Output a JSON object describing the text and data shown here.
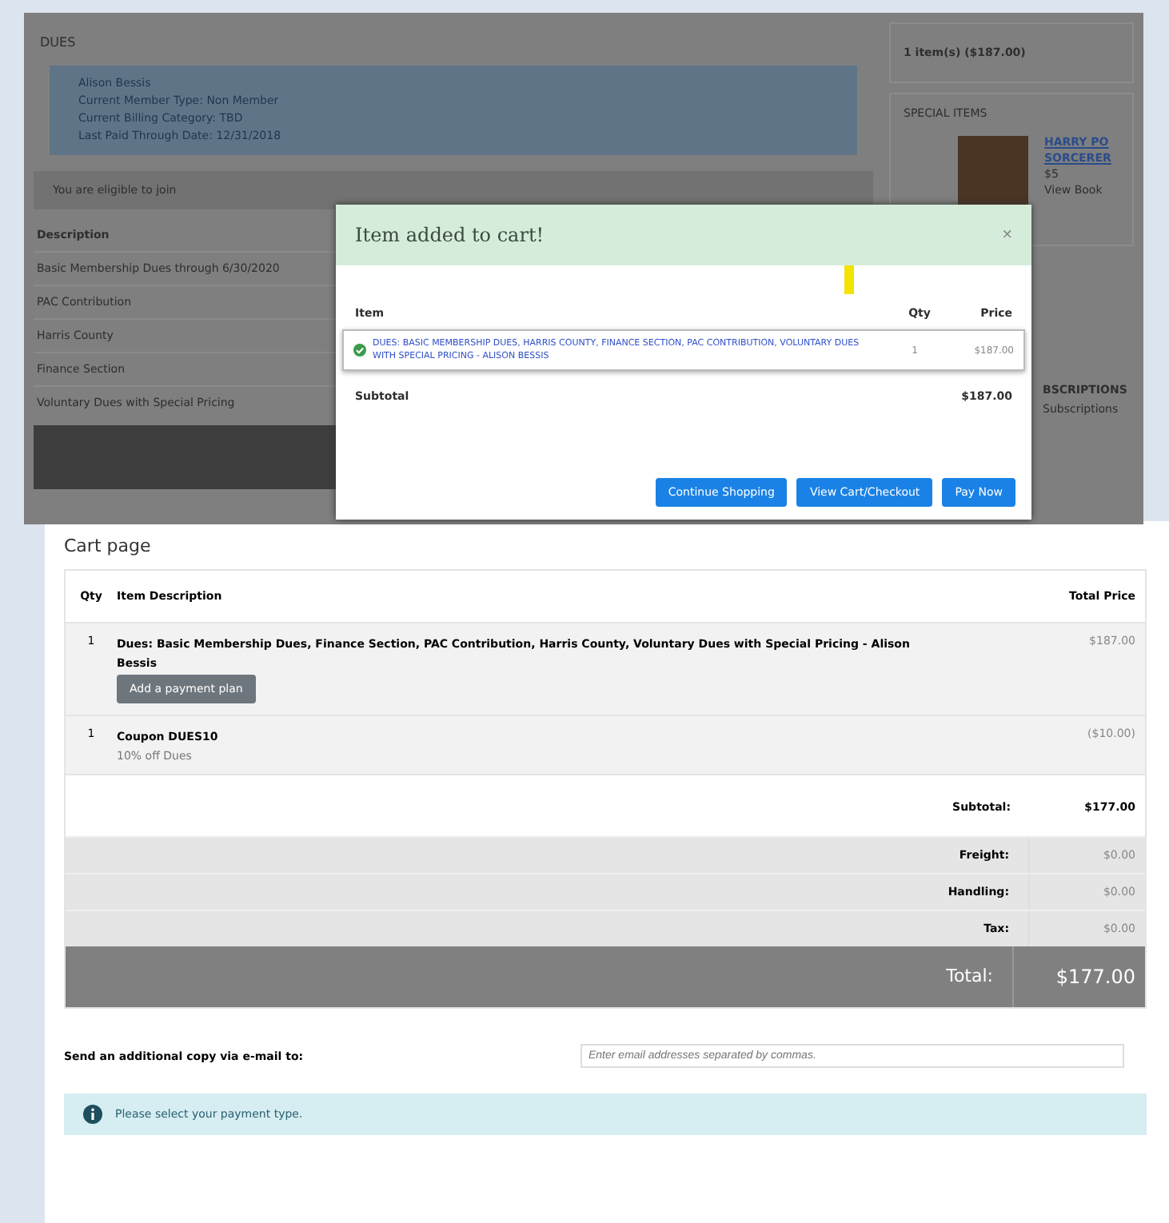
{
  "background_page": {
    "heading": "DUES",
    "member_info": [
      "Alison Bessis",
      "Current Member Type: Non Member",
      "Current Billing Category: TBD",
      "Last Paid Through Date: 12/31/2018"
    ],
    "eligibility": "You are eligible to join",
    "description_heading": "Description",
    "dues_items": [
      "Basic Membership Dues through 6/30/2020",
      "PAC Contribution",
      "Harris County",
      "Finance Section",
      "Voluntary Dues with Special Pricing"
    ],
    "sidebar": {
      "cart_summary": "1 item(s) ($187.00)",
      "special_items_heading": "SPECIAL ITEMS",
      "special_item": {
        "title_lines": [
          "HARRY PO",
          "SORCERER"
        ],
        "price": "$5",
        "link": "View Book"
      },
      "subscriptions_heading": "BSCRIPTIONS",
      "subscription_lines": [
        "Subscriptions"
      ]
    }
  },
  "modal": {
    "title": "Item added to cart!",
    "close": "×",
    "columns": [
      "Item",
      "Qty",
      "Price"
    ],
    "item": {
      "name": "DUES: BASIC MEMBERSHIP DUES, HARRIS COUNTY, FINANCE SECTION, PAC CONTRIBUTION, VOLUNTARY DUES WITH SPECIAL PRICING - ALISON BESSIS",
      "qty": "1",
      "price": "$187.00",
      "added": true
    },
    "subtotal_label": "Subtotal",
    "subtotal": "$187.00",
    "buttons": [
      "Continue Shopping",
      "View Cart/Checkout",
      "Pay Now"
    ]
  },
  "cart_page": {
    "title": "Cart page",
    "columns": [
      "Qty",
      "Item Description",
      "Total Price"
    ],
    "rows": [
      {
        "qty": "1",
        "description": "Dues: Basic Membership Dues, Finance Section, PAC Contribution, Harris County, Voluntary Dues with Special Pricing - Alison Bessis",
        "action": "Add a payment plan",
        "price": "$187.00"
      },
      {
        "qty": "1",
        "description": "Coupon DUES10",
        "detail": "10% off Dues",
        "price": "($10.00)"
      }
    ],
    "subtotal": {
      "label": "Subtotal:",
      "value": "$177.00"
    },
    "charges": [
      {
        "label": "Freight:",
        "value": "$0.00"
      },
      {
        "label": "Handling:",
        "value": "$0.00"
      },
      {
        "label": "Tax:",
        "value": "$0.00"
      }
    ],
    "total": {
      "label": "Total:",
      "value": "$177.00"
    },
    "email": {
      "label": "Send an additional copy via e-mail to:",
      "placeholder": "Enter email addresses separated by commas."
    },
    "alert": "Please select your payment type."
  }
}
